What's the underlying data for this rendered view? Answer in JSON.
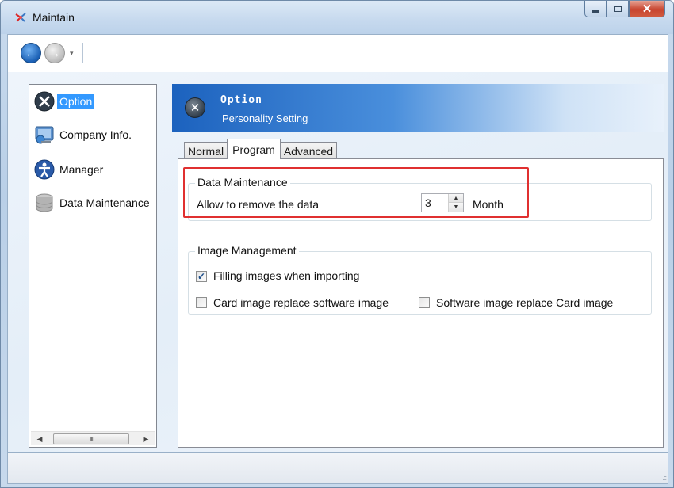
{
  "window": {
    "title": "Maintain"
  },
  "nav": {
    "back_glyph": "←",
    "forward_glyph": "→",
    "dropdown_glyph": "▾"
  },
  "sidebar": {
    "items": [
      {
        "label": "Option",
        "icon": "option-icon",
        "selected": true
      },
      {
        "label": "Company Info.",
        "icon": "company-icon",
        "selected": false
      },
      {
        "label": "Manager",
        "icon": "manager-icon",
        "selected": false
      },
      {
        "label": "Data Maintenance",
        "icon": "database-icon",
        "selected": false
      }
    ],
    "scrollbar": {
      "left_glyph": "◀",
      "right_glyph": "▶",
      "thumb_grip": "III"
    }
  },
  "header": {
    "title": "Option",
    "subtitle": "Personality Setting"
  },
  "tabs": [
    {
      "label": "Normal",
      "active": false
    },
    {
      "label": "Program",
      "active": true
    },
    {
      "label": "Advanced",
      "active": false
    }
  ],
  "data_maintenance": {
    "legend": "Data Maintenance",
    "label": "Allow to remove the data",
    "value": "3",
    "unit": "Month"
  },
  "image_management": {
    "legend": "Image Management",
    "options": [
      {
        "label": "Filling  images when importing",
        "checked": true
      },
      {
        "label": "Card image replace software image",
        "checked": false
      },
      {
        "label": "Software image replace Card image",
        "checked": false
      }
    ]
  },
  "colors": {
    "selection": "#3399ff",
    "banner_start": "#1c62be",
    "highlight_border": "#e03030"
  }
}
